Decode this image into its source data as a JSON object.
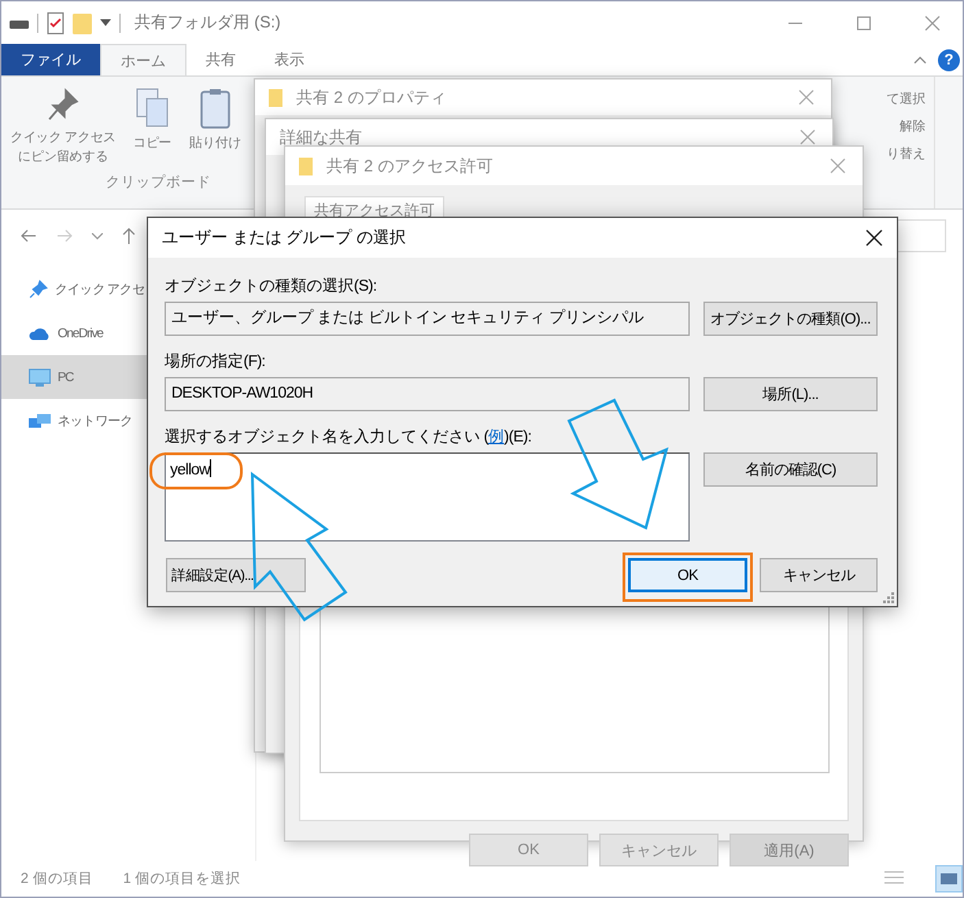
{
  "explorer": {
    "title": "共有フォルダ用 (S:)",
    "ribbon_tabs": [
      {
        "label": "ファイル",
        "kind": "file",
        "selected": false
      },
      {
        "label": "ホーム",
        "kind": "tab",
        "selected": true
      },
      {
        "label": "共有",
        "kind": "tab",
        "selected": false
      },
      {
        "label": "表示",
        "kind": "tab",
        "selected": false
      }
    ],
    "help": "?",
    "ribbon_buttons": [
      {
        "lines": [
          "クイック アクセス",
          "にピン留めする"
        ],
        "kind": "pin"
      },
      {
        "label": "コピー",
        "kind": "copy"
      },
      {
        "label": "貼り付け",
        "kind": "paste"
      }
    ],
    "ribbon_group": "クリップボード",
    "ribbon_right_items": [
      "て選択",
      "解除",
      "り替え"
    ],
    "sidebar": [
      {
        "label": "クイック アクセ",
        "kind": "star",
        "selected": false
      },
      {
        "label": "OneDrive",
        "kind": "cloud",
        "selected": false
      },
      {
        "label": "PC",
        "kind": "pc",
        "selected": true
      },
      {
        "label": "ネットワーク",
        "kind": "network",
        "selected": false
      }
    ],
    "status_bar": [
      "2 個の項目",
      "1 個の項目を選択"
    ]
  },
  "properties_window": {
    "title": "共有 2 のプロパティ"
  },
  "advanced_window": {
    "title": "詳細な共有"
  },
  "permissions_window": {
    "title": "共有 2 のアクセス許可",
    "tab": "共有アクセス許可",
    "buttons": [
      {
        "label": "OK",
        "disabled": false
      },
      {
        "label": "キャンセル",
        "disabled": false
      },
      {
        "label": "適用(A)",
        "disabled": true
      }
    ]
  },
  "dialog": {
    "title": "ユーザー または グループ の選択",
    "fields": [
      {
        "label": "オブジェクトの種類の選択(S):",
        "value": "ユーザー、グループ または ビルトイン セキュリティ プリンシパル",
        "button": "オブジェクトの種類(O)..."
      },
      {
        "label": "場所の指定(F):",
        "value": "DESKTOP-AW1020H",
        "button": "場所(L)..."
      }
    ],
    "names_label_before": "選択するオブジェクト名を入力してください (",
    "example_link": "例",
    "names_label_after": ")(E):",
    "names_value": "yellow",
    "check_button": "名前の確認(C)",
    "advanced_button": "詳細設定(A)...",
    "ok_button": {
      "label": "OK",
      "default": true
    },
    "cancel_button": "キャンセル"
  }
}
